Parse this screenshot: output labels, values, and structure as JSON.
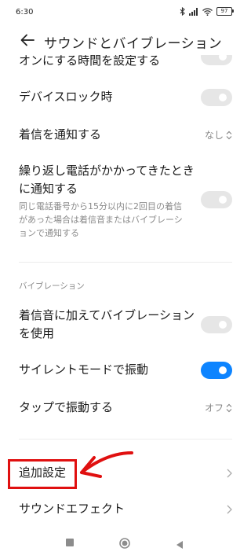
{
  "status_bar": {
    "time": "6:30",
    "battery": "97"
  },
  "header": {
    "title": "サウンドとバイブレーション"
  },
  "settings": {
    "partial_item": {
      "label": "オンにする時間を設定する"
    },
    "device_lock": {
      "label": "デバイスロック時"
    },
    "notify_incoming": {
      "label": "着信を通知する",
      "value": "なし"
    },
    "repeated_calls": {
      "label_line1": "繰り返し電話がかかってきたとき",
      "label_line2": "に通知する",
      "sub_line1": "同じ電話番号から15分以内に2回目の着信",
      "sub_line2": "があった場合は着信音またはバイブレーシ",
      "sub_line3": "ョンで通知する"
    },
    "vibration_section": {
      "header": "バイブレーション"
    },
    "vibrate_with_ringtone": {
      "label_line1": "着信音に加えてバイブレーション",
      "label_line2": "を使用"
    },
    "silent_vibrate": {
      "label": "サイレントモードで振動"
    },
    "tap_vibrate": {
      "label": "タップで振動する",
      "value": "オフ"
    },
    "additional_settings": {
      "label": "追加設定"
    },
    "sound_effects": {
      "label": "サウンドエフェクト"
    }
  },
  "toggles": {
    "device_lock": false,
    "repeated_calls": false,
    "vibrate_with_ringtone": false,
    "silent_vibrate": true
  },
  "colors": {
    "accent": "#0d84ff",
    "annotation": "#e01010",
    "toggle_off": "#e6e6e6"
  },
  "icons": [
    "bluetooth-icon",
    "signal-icon",
    "wifi-icon",
    "battery-icon",
    "back-arrow-icon",
    "updown-icon",
    "chevron-right-icon",
    "annotation-arrow-icon",
    "nav-recents-icon",
    "nav-home-icon",
    "nav-back-icon"
  ]
}
